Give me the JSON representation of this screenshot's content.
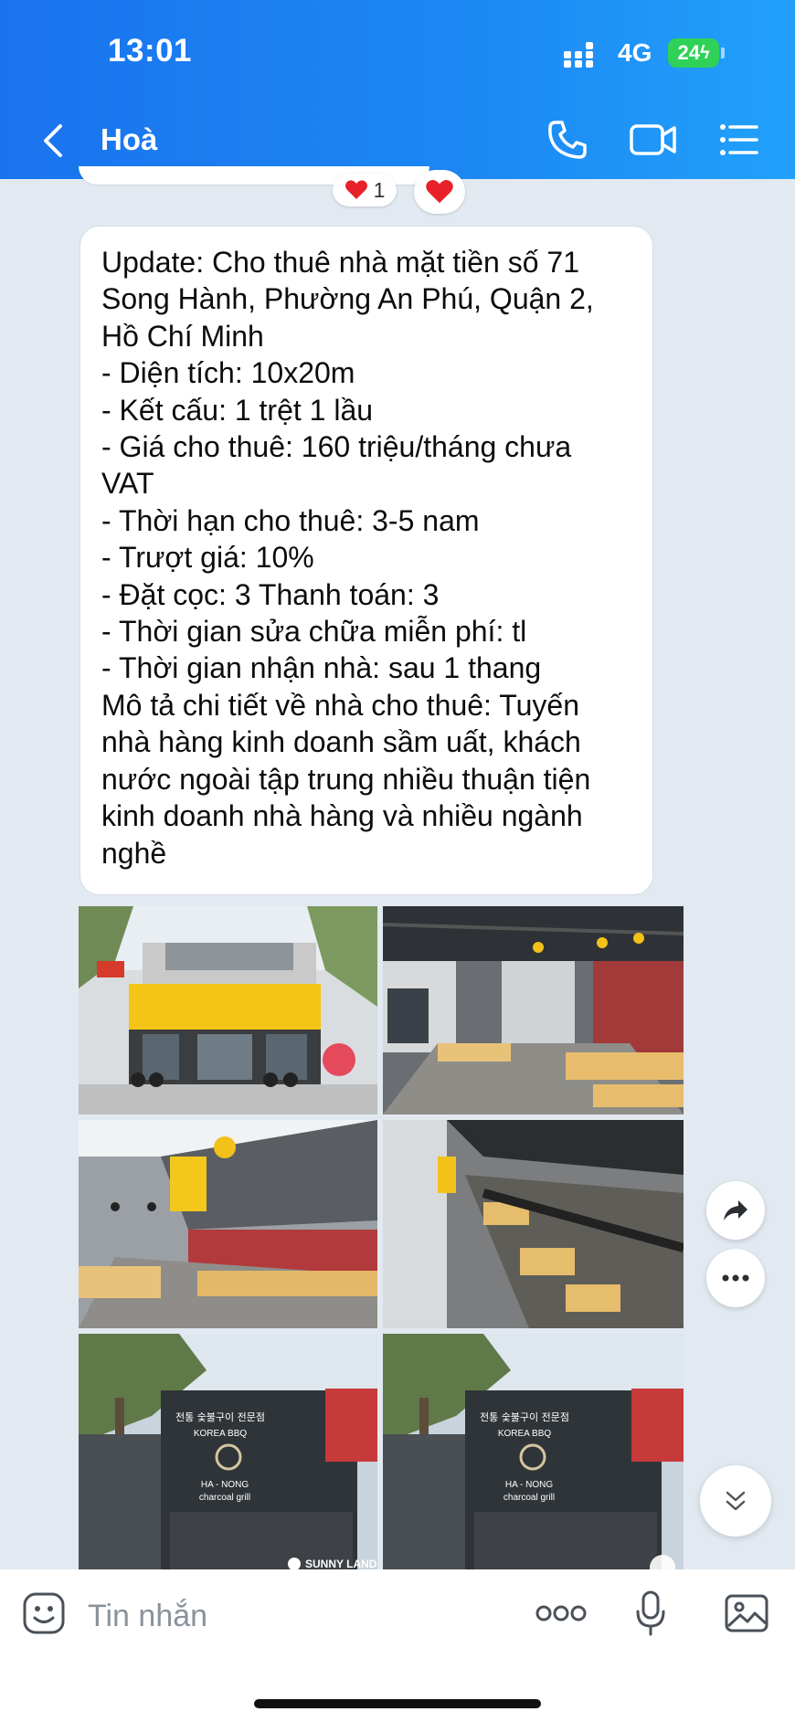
{
  "status_bar": {
    "time": "13:01",
    "network": "4G",
    "battery": "24"
  },
  "header": {
    "contact_name": "Hoà"
  },
  "reactions": {
    "heart_count": "1"
  },
  "message": {
    "lines": [
      "Update: Cho thuê nhà mặt tiền số 71",
      "Song Hành, Phường An Phú, Quận 2,",
      "Hồ Chí Minh",
      "- Diện tích: 10x20m",
      "- Kết cấu: 1 trệt 1 lầu",
      "- Giá cho thuê: 160 triệu/tháng chưa",
      "VAT",
      "- Thời hạn cho thuê: 3-5 nam",
      "- Trượt giá: 10%",
      "- Đặt cọc: 3 Thanh toán: 3",
      "- Thời gian sửa chữa miễn phí: tl",
      "- Thời gian nhận nhà: sau 1 thang",
      "Mô tả chi tiết về nhà cho thuê: Tuyến",
      "nhà hàng kinh doanh sầm uất, khách",
      "nước ngoài tập trung nhiều thuận tiện",
      "kinh doanh nhà hàng và nhiều ngành",
      "nghề"
    ]
  },
  "photos": {
    "sign_korean": "전통 숯불구이 전문점",
    "sign_brand": "KOREA BBQ",
    "sign_name": "HA - NONG",
    "sign_sub": "charcoal grill",
    "watermark": "SUNNY LAND"
  },
  "composer": {
    "placeholder": "Tin nhắn"
  },
  "colors": {
    "header_start": "#1a73ee",
    "header_end": "#21a1fb",
    "accent": "#1c88f4"
  }
}
